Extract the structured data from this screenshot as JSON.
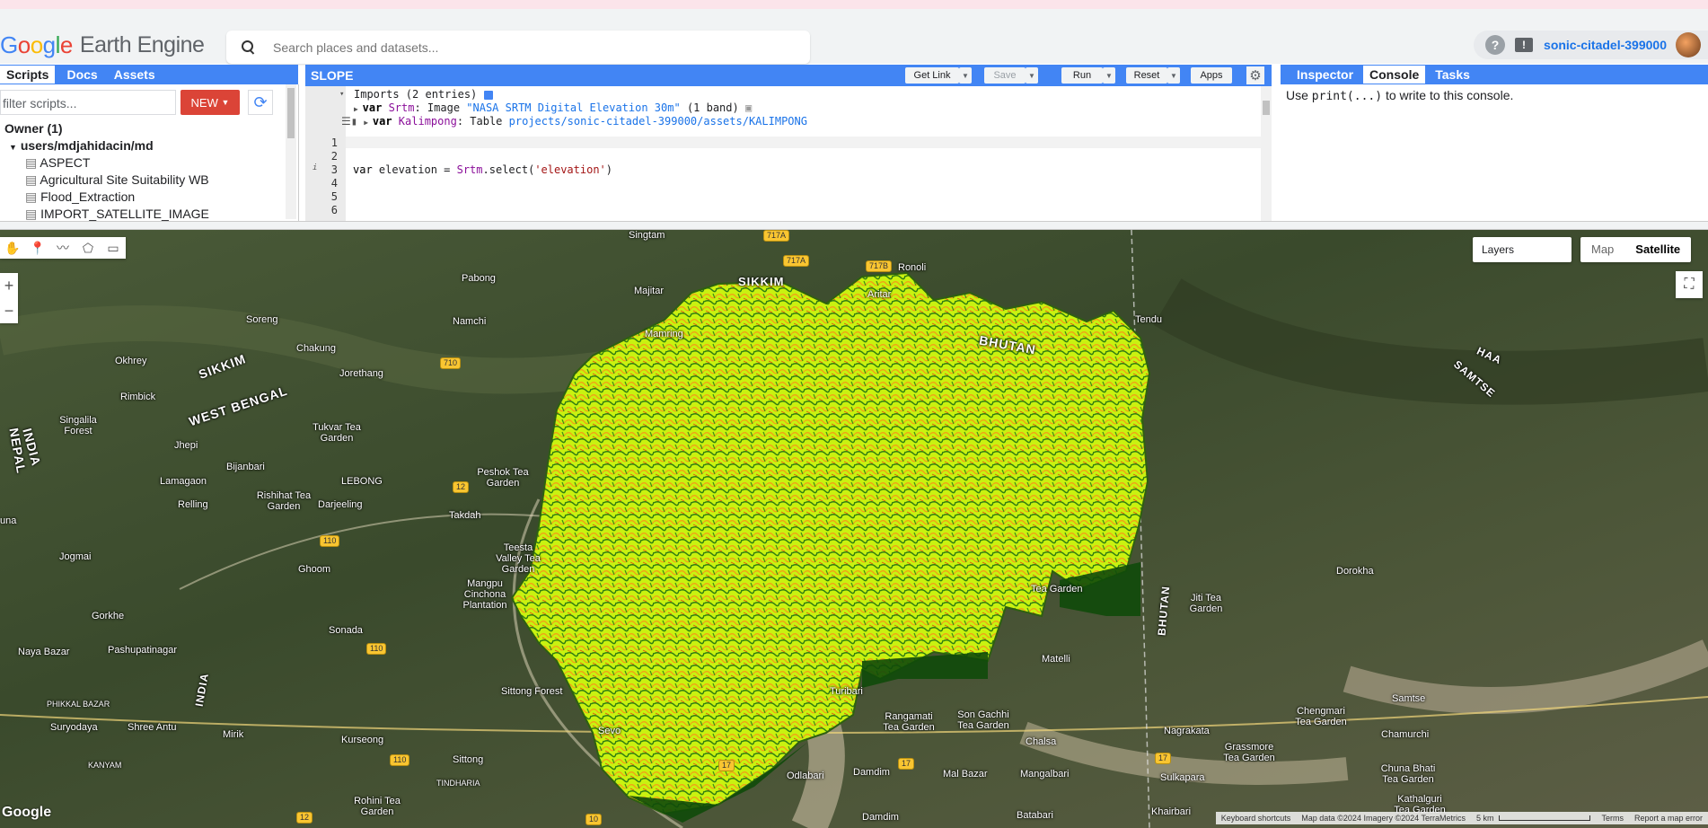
{
  "header": {
    "logo_google": [
      "G",
      "o",
      "o",
      "g",
      "l",
      "e"
    ],
    "logo_product": "Earth Engine",
    "search_placeholder": "Search places and datasets...",
    "help_icon": "?",
    "feedback_icon": "!",
    "project": "sonic-citadel-399000"
  },
  "left_panel": {
    "tabs": [
      "Scripts",
      "Docs",
      "Assets"
    ],
    "active_tab": "Scripts",
    "filter_placeholder": "filter scripts...",
    "new_label": "NEW",
    "tree": {
      "owner": "Owner (1)",
      "repo": "users/mdjahidacin/md",
      "files": [
        "ASPECT",
        "Agricultural Site Suitability WB",
        "Flood_Extraction",
        "IMPORT_SATELLITE_IMAGE"
      ]
    }
  },
  "editor": {
    "title": "SLOPE",
    "buttons": {
      "get_link": "Get Link",
      "save": "Save",
      "run": "Run",
      "reset": "Reset",
      "apps": "Apps"
    },
    "imports_label": "Imports (2 entries)",
    "imports": [
      {
        "kw": "var",
        "name": "Srtm",
        "type": "Image",
        "value": "\"NASA SRTM Digital Elevation 30m\"",
        "extra": "(1 band)"
      },
      {
        "kw": "var",
        "name": "Kalimpong",
        "type": "Table",
        "value": "projects/sonic-citadel-399000/assets/KALIMPONG",
        "extra": ""
      }
    ],
    "line_numbers": [
      "1",
      "2",
      "3",
      "4",
      "5",
      "6"
    ],
    "code_line3": {
      "kw": "var",
      "name": " elevation = ",
      "obj": "Srtm",
      "method": ".select(",
      "arg": "'elevation'",
      "close": ")"
    }
  },
  "right_panel": {
    "tabs": [
      "Inspector",
      "Console",
      "Tasks"
    ],
    "active_tab": "Console",
    "console_pre": "Use ",
    "console_code": "print(...)",
    "console_post": " to write to this console."
  },
  "map": {
    "layers_label": "Layers",
    "map_type": [
      "Map",
      "Satellite"
    ],
    "selected_type": "Satellite",
    "labels": [
      "Singtam",
      "SIKKIM",
      "Ronoli",
      "Pabong",
      "Majitar",
      "Aritar",
      "Soreng",
      "Namchi",
      "Mamring",
      "BHUTAN",
      "Chakung",
      "Okhrey",
      "Jorethang",
      "Rimbick",
      "SIKKIM",
      "WEST BENGAL",
      "Singalila Forest",
      "Tukvar Tea Garden",
      "Tendu",
      "INDIA",
      "NEPAL",
      "Jhepi",
      "Bijanbari",
      "Lamagaon",
      "LEBONG",
      "Peshok Tea Garden",
      "Rishihat Tea Garden",
      "Relling",
      "Darjeeling",
      "Takdah",
      "una",
      "Teesta Valley Tea Garden",
      "Jogmai",
      "Ghoom",
      "Gorkhe",
      "Sonada",
      "Mangpu Cinchona Plantation",
      "Naya Bazar",
      "Pashupatinagar",
      "INDIA",
      "Sittong Forest",
      "PHIKKAL BAZAR",
      "Suryodaya",
      "Shree Antu",
      "Mirik",
      "KANYAM",
      "Kurseong",
      "Sittong",
      "TINDHARIA",
      "Rohini Tea Garden",
      "Sevo",
      "Turibari",
      "Rangamati Tea Garden",
      "Son Gachhi Tea Garden",
      "Chalsa",
      "Damdim",
      "Mal Bazar",
      "Mangalbari",
      "Odlabari",
      "Batabari",
      "Damdim",
      "Matelli",
      "Tea Garden",
      "BHUTAN",
      "Jiti Tea Garden",
      "Dorokha",
      "Samtse",
      "HAA",
      "SAMTSE",
      "Nagrakata",
      "Grassmore Tea Garden",
      "Sulkapara",
      "Khairbari",
      "Chengmari Tea Garden",
      "Chamurchi",
      "Chuna Bhati Tea Garden",
      "Kathalguri Tea Garden"
    ],
    "roads": [
      "717A",
      "717A",
      "717B",
      "710",
      "12",
      "110",
      "110",
      "110",
      "17",
      "17",
      "10",
      "12",
      "17"
    ],
    "google_logo": "Google",
    "attribution": [
      "Keyboard shortcuts",
      "Map data ©2024 Imagery ©2024 TerraMetrics",
      "5 km",
      "Terms",
      "Report a map error"
    ]
  }
}
